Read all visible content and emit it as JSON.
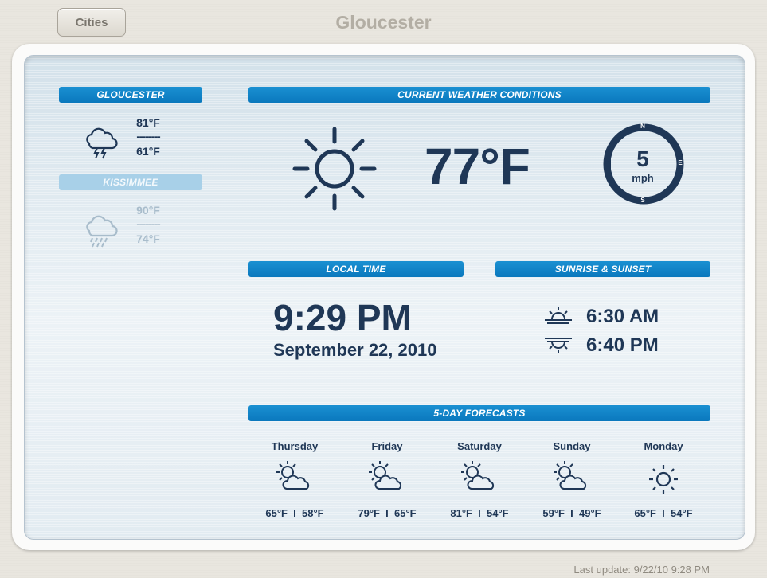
{
  "header": {
    "cities_button": "Cities",
    "title": "Gloucester"
  },
  "cities": [
    {
      "name": "GLOUCESTER",
      "high": "81°F",
      "low": "61°F",
      "dash": "--------",
      "icon": "thunderstorm-icon",
      "active": true
    },
    {
      "name": "KISSIMMEE",
      "high": "90°F",
      "low": "74°F",
      "dash": "--------",
      "icon": "rain-icon",
      "active": false
    }
  ],
  "current": {
    "header": "CURRENT WEATHER CONDITIONS",
    "icon": "sun-icon",
    "temperature": "77°F",
    "wind": {
      "speed": "5",
      "unit": "mph",
      "north": "N",
      "east": "E",
      "south": "S"
    }
  },
  "local_time": {
    "header": "LOCAL TIME",
    "time": "9:29 PM",
    "date": "September 22, 2010"
  },
  "sun": {
    "header": "SUNRISE & SUNSET",
    "sunrise": "6:30 AM",
    "sunset": "6:40 PM"
  },
  "forecast": {
    "header": "5-DAY FORECASTS",
    "days": [
      {
        "day": "Thursday",
        "temps": "65°F  I  58°F",
        "icon": "partly-cloudy-icon"
      },
      {
        "day": "Friday",
        "temps": "79°F  I  65°F",
        "icon": "partly-cloudy-icon"
      },
      {
        "day": "Saturday",
        "temps": "81°F  I  54°F",
        "icon": "partly-cloudy-icon"
      },
      {
        "day": "Sunday",
        "temps": "59°F  I  49°F",
        "icon": "partly-cloudy-icon"
      },
      {
        "day": "Monday",
        "temps": "65°F  I  54°F",
        "icon": "sun-icon"
      }
    ]
  },
  "footer": {
    "last_update": "Last update: 9/22/10 9:28 PM"
  },
  "colors": {
    "accent": "#0a78bd",
    "text": "#1f3756",
    "inactive_tab": "#a8d0e8",
    "faded_text": "#a8bccb"
  }
}
